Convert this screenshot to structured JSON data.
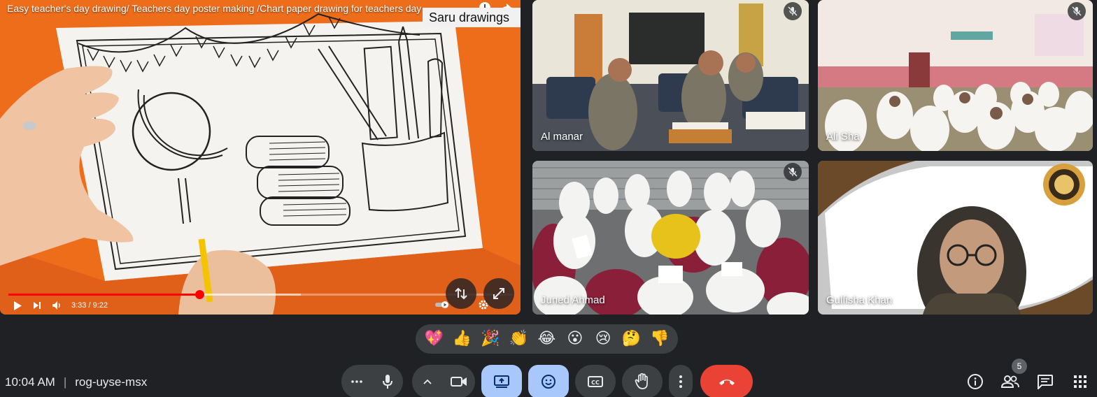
{
  "presentation": {
    "video_title": "Easy teacher's day drawing/ Teachers day poster making /Chart paper drawing for teachers day",
    "channel_badge": "Saru drawings",
    "time_display": "3:33 / 9:22",
    "progress_fraction": 0.379,
    "buffered_fraction": 0.58
  },
  "participants": [
    {
      "name": "Al manar",
      "muted": true
    },
    {
      "name": "Ali Sha",
      "muted": true
    },
    {
      "name": "Juned Ahmad",
      "muted": true
    },
    {
      "name": "Gulfisha Khan",
      "muted": false,
      "active_speaker": true
    }
  ],
  "reactions": [
    "💖",
    "👍",
    "🎉",
    "👏",
    "😂",
    "😮",
    "😢",
    "🤔",
    "👎"
  ],
  "meeting": {
    "time": "10:04 AM",
    "code": "rog-uyse-msx",
    "people_count": "5"
  },
  "colors": {
    "background": "#202124",
    "control": "#3c4043",
    "active_control": "#a8c7fa",
    "end_call": "#ea4335",
    "progress": "#ff0000"
  }
}
